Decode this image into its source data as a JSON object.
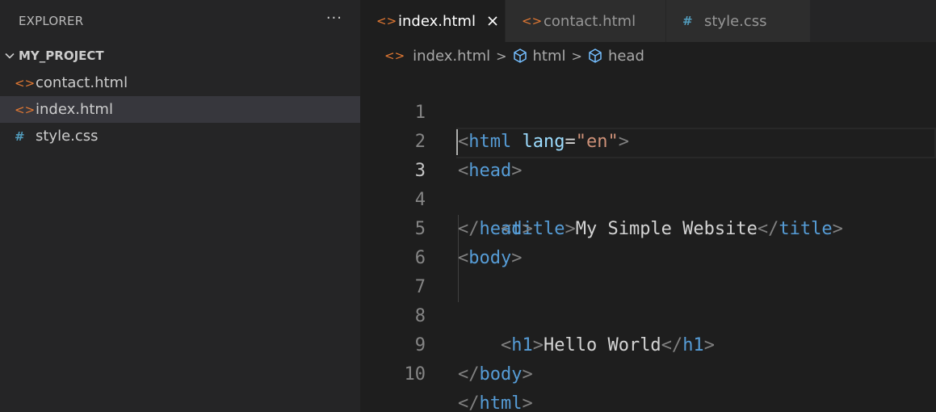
{
  "sidebar": {
    "title": "EXPLORER",
    "more_label": "···",
    "project_name": "MY_PROJECT",
    "files": [
      {
        "icon": "<>",
        "label": "contact.html",
        "type": "html"
      },
      {
        "icon": "<>",
        "label": "index.html",
        "type": "html",
        "selected": true
      },
      {
        "icon": "#",
        "label": "style.css",
        "type": "css"
      }
    ]
  },
  "tabs": [
    {
      "icon": "<>",
      "label": "index.html",
      "type": "html",
      "active": true
    },
    {
      "icon": "<>",
      "label": "contact.html",
      "type": "html"
    },
    {
      "icon": "#",
      "label": "style.css",
      "type": "css"
    }
  ],
  "breadcrumb": {
    "file_icon": "<>",
    "file": "index.html",
    "sep": ">",
    "item1": "html",
    "item2": "head"
  },
  "editor": {
    "line_numbers": [
      "1",
      "2",
      "3",
      "4",
      "5",
      "6",
      "7",
      "8",
      "9",
      "10"
    ],
    "current_line": 3,
    "code": {
      "l1": {
        "b1": "<",
        "tag": "html",
        "sp": " ",
        "attr": "lang",
        "eq": "=",
        "str": "\"en\"",
        "b2": ">"
      },
      "l2": {
        "b1": "<",
        "tag": "head",
        "b2": ">"
      },
      "l3": {
        "indent": "    ",
        "b1": "<",
        "tag": "title",
        "b2": ">",
        "text": "My Simple Website",
        "b3": "</",
        "tag2": "title",
        "b4": ">"
      },
      "l4": {
        "b1": "</",
        "tag": "head",
        "b2": ">"
      },
      "l5": {
        "b1": "<",
        "tag": "body",
        "b2": ">"
      },
      "l7": {
        "indent": "    ",
        "b1": "<",
        "tag": "h1",
        "b2": ">",
        "text": "Hello World",
        "b3": "</",
        "tag2": "h1",
        "b4": ">"
      },
      "l9": {
        "b1": "</",
        "tag": "body",
        "b2": ">"
      },
      "l10": {
        "b1": "</",
        "tag": "html",
        "b2": ">"
      }
    }
  },
  "colors": {
    "html_icon": "#e37933",
    "css_icon": "#519aba",
    "tag": "#569cd6",
    "attr": "#9cdcfe",
    "string": "#ce9178",
    "bracket": "#808080"
  }
}
